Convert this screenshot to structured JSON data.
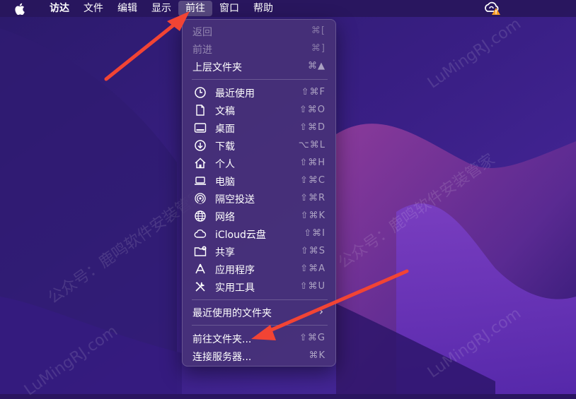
{
  "menubar": {
    "items": [
      {
        "label": "访达",
        "bold": true
      },
      {
        "label": "文件"
      },
      {
        "label": "编辑"
      },
      {
        "label": "显示"
      },
      {
        "label": "前往",
        "active": true
      },
      {
        "label": "窗口"
      },
      {
        "label": "帮助"
      }
    ]
  },
  "go_menu": {
    "back": {
      "label": "返回",
      "shortcut": "⌘["
    },
    "forward": {
      "label": "前进",
      "shortcut": "⌘]"
    },
    "enclosing": {
      "label": "上层文件夹",
      "shortcut": "⌘▲"
    },
    "locations": [
      {
        "label": "最近使用",
        "shortcut": "⇧⌘F",
        "icon": "clock-icon"
      },
      {
        "label": "文稿",
        "shortcut": "⇧⌘O",
        "icon": "document-icon"
      },
      {
        "label": "桌面",
        "shortcut": "⇧⌘D",
        "icon": "desktop-icon"
      },
      {
        "label": "下载",
        "shortcut": "⌥⌘L",
        "icon": "download-icon"
      },
      {
        "label": "个人",
        "shortcut": "⇧⌘H",
        "icon": "home-icon"
      },
      {
        "label": "电脑",
        "shortcut": "⇧⌘C",
        "icon": "laptop-icon"
      },
      {
        "label": "隔空投送",
        "shortcut": "⇧⌘R",
        "icon": "airdrop-icon"
      },
      {
        "label": "网络",
        "shortcut": "⇧⌘K",
        "icon": "globe-icon"
      },
      {
        "label": "iCloud云盘",
        "shortcut": "⇧⌘I",
        "icon": "cloud-icon"
      },
      {
        "label": "共享",
        "shortcut": "⇧⌘S",
        "icon": "shared-folder-icon"
      },
      {
        "label": "应用程序",
        "shortcut": "⇧⌘A",
        "icon": "applications-icon"
      },
      {
        "label": "实用工具",
        "shortcut": "⇧⌘U",
        "icon": "utilities-icon"
      }
    ],
    "recent_folders": {
      "label": "最近使用的文件夹",
      "chevron": "›"
    },
    "go_to_folder": {
      "label": "前往文件夹...",
      "shortcut": "⇧⌘G"
    },
    "connect_server": {
      "label": "连接服务器...",
      "shortcut": "⌘K"
    }
  },
  "watermarks": {
    "text_cn": "公众号：鹿鸣软件安装管家",
    "text_en": "LuMingRJ.com"
  },
  "colors": {
    "arrow": "#f24434",
    "menu_bg": "#483278",
    "menubar_bg": "#28165c"
  }
}
